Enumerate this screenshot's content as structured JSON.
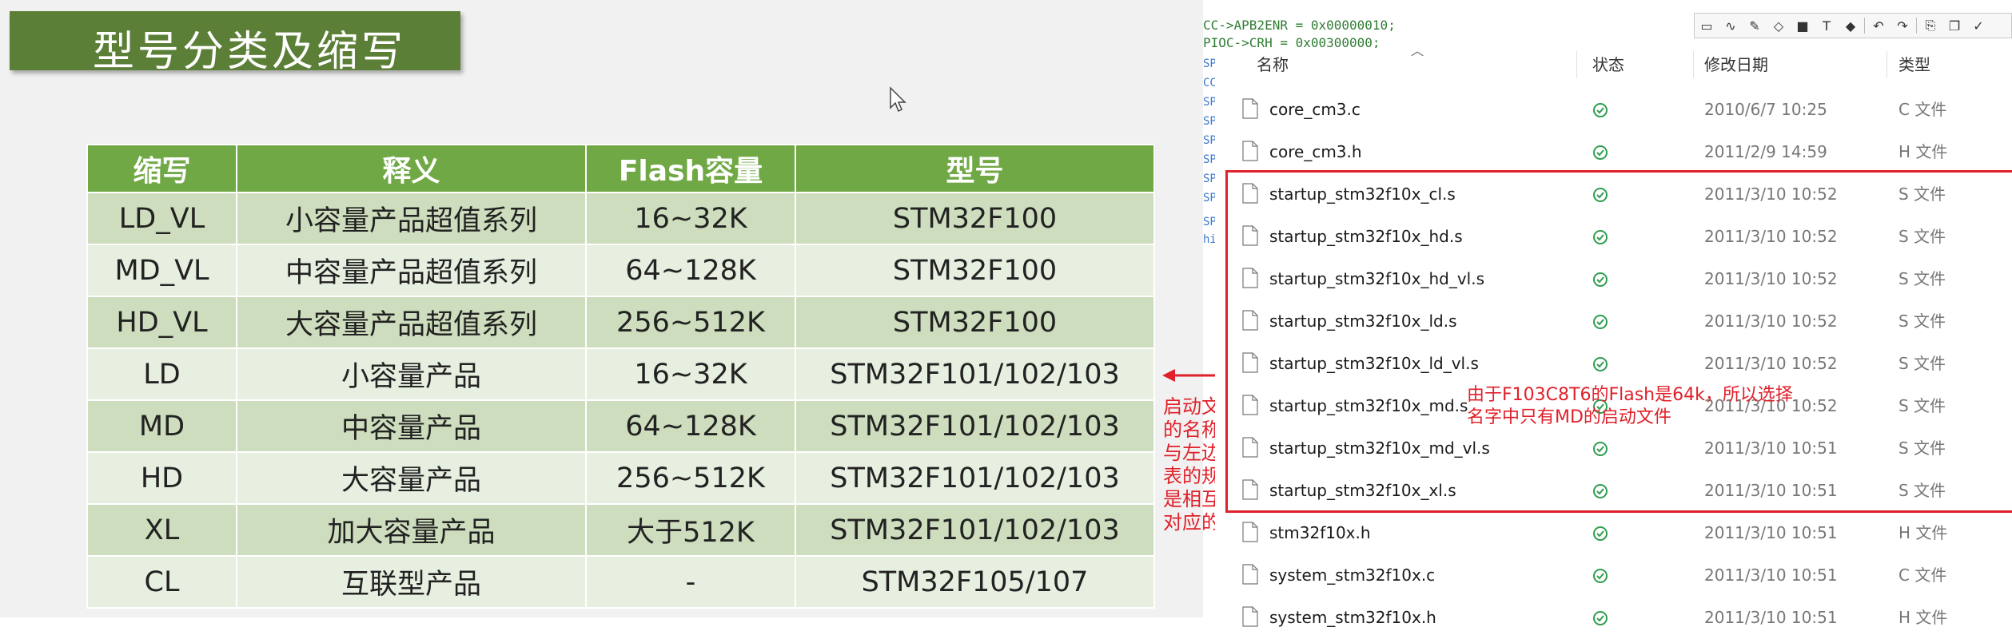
{
  "slide": {
    "title": "型号分类及缩写",
    "table": {
      "headers": [
        "缩写",
        "释义",
        "Flash容量",
        "型号"
      ],
      "rows": [
        [
          "LD_VL",
          "小容量产品超值系列",
          "16~32K",
          "STM32F100"
        ],
        [
          "MD_VL",
          "中容量产品超值系列",
          "64~128K",
          "STM32F100"
        ],
        [
          "HD_VL",
          "大容量产品超值系列",
          "256~512K",
          "STM32F100"
        ],
        [
          "LD",
          "小容量产品",
          "16~32K",
          "STM32F101/102/103"
        ],
        [
          "MD",
          "中容量产品",
          "64~128K",
          "STM32F101/102/103"
        ],
        [
          "HD",
          "大容量产品",
          "256~512K",
          "STM32F101/102/103"
        ],
        [
          "XL",
          "加大容量产品",
          "大于512K",
          "STM32F101/102/103"
        ],
        [
          "CL",
          "互联型产品",
          "-",
          "STM32F105/107"
        ]
      ]
    },
    "colors": {
      "title_bg": "#5b7f36",
      "header_bg": "#70a845",
      "row_dark": "#cdddbd",
      "row_light": "#e7efe0"
    }
  },
  "annotation_left": {
    "lines": [
      "启动文件",
      "的名称",
      "与左边",
      "表的规则",
      "是相互",
      "对应的"
    ],
    "color": "#e0202a"
  },
  "code": {
    "line1": "CC->APB2ENR = 0x00000010;",
    "line2": "PIOC->CRH = 0x00300000;",
    "fragments": [
      "SPI",
      "CC",
      "SPI",
      "SPI",
      "SPI",
      "SPI",
      "SPI",
      "SPI",
      "SPI",
      "hi"
    ]
  },
  "toolbar": {
    "buttons": [
      "▭",
      "∿",
      "✎",
      "◇",
      "■",
      "T",
      "◆",
      "↶",
      "↷",
      "⎘",
      "❐",
      "✓"
    ]
  },
  "explorer": {
    "columns": [
      "名称",
      "状态",
      "修改日期",
      "类型"
    ],
    "files": [
      {
        "name": "core_cm3.c",
        "date": "2010/6/7 10:25",
        "type": "C 文件"
      },
      {
        "name": "core_cm3.h",
        "date": "2011/2/9 14:59",
        "type": "H 文件"
      },
      {
        "name": "startup_stm32f10x_cl.s",
        "date": "2011/3/10 10:52",
        "type": "S 文件"
      },
      {
        "name": "startup_stm32f10x_hd.s",
        "date": "2011/3/10 10:52",
        "type": "S 文件"
      },
      {
        "name": "startup_stm32f10x_hd_vl.s",
        "date": "2011/3/10 10:52",
        "type": "S 文件"
      },
      {
        "name": "startup_stm32f10x_ld.s",
        "date": "2011/3/10 10:52",
        "type": "S 文件"
      },
      {
        "name": "startup_stm32f10x_ld_vl.s",
        "date": "2011/3/10 10:52",
        "type": "S 文件"
      },
      {
        "name": "startup_stm32f10x_md.s",
        "date": "2011/3/10 10:52",
        "type": "S 文件"
      },
      {
        "name": "startup_stm32f10x_md_vl.s",
        "date": "2011/3/10 10:51",
        "type": "S 文件"
      },
      {
        "name": "startup_stm32f10x_xl.s",
        "date": "2011/3/10 10:51",
        "type": "S 文件"
      },
      {
        "name": "stm32f10x.h",
        "date": "2011/3/10 10:51",
        "type": "H 文件"
      },
      {
        "name": "system_stm32f10x.c",
        "date": "2011/3/10 10:51",
        "type": "C 文件"
      },
      {
        "name": "system_stm32f10x.h",
        "date": "2011/3/10 10:51",
        "type": "H 文件"
      }
    ],
    "status_color": "#2e9e4f"
  },
  "annotation_right": {
    "line1": "由于F103C8T6的Flash是64k，所以选择",
    "line2": "名字中只有MD的启动文件"
  }
}
